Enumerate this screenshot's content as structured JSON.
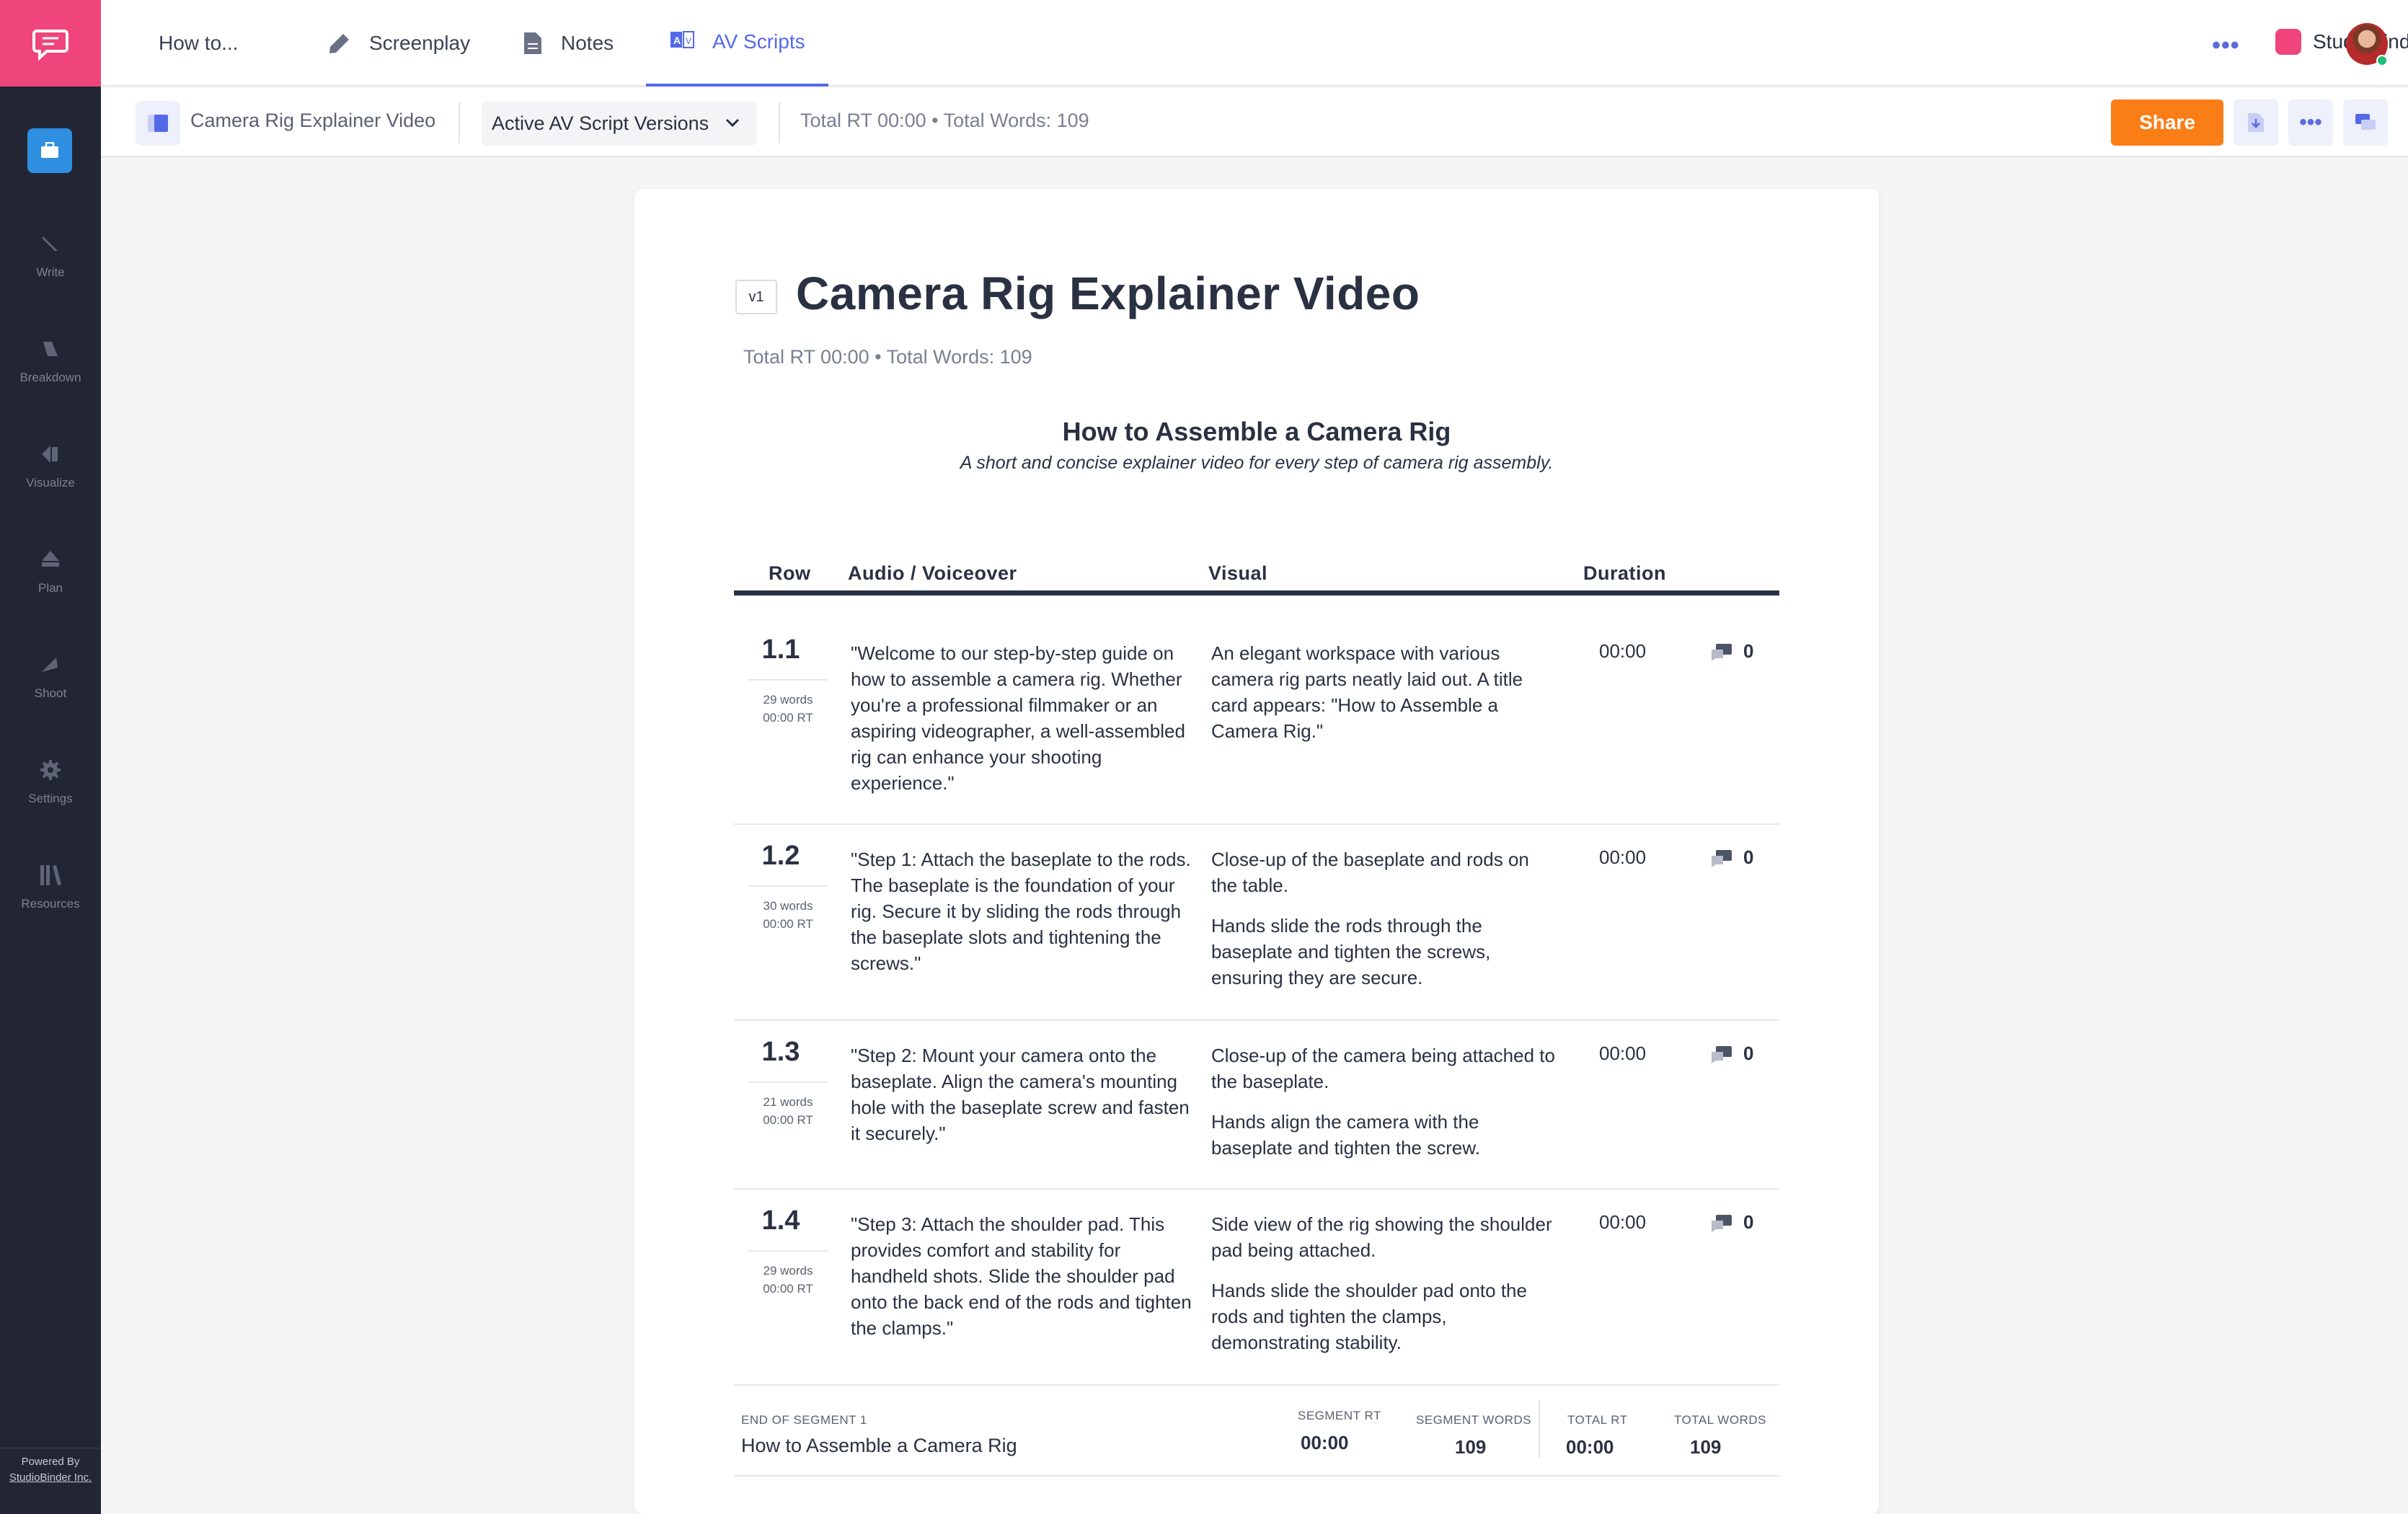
{
  "sidebar": {
    "items": [
      {
        "label": "Write",
        "icon": "pencil-icon"
      },
      {
        "label": "Breakdown",
        "icon": "breakdown-icon"
      },
      {
        "label": "Visualize",
        "icon": "visualize-icon"
      },
      {
        "label": "Plan",
        "icon": "plan-icon"
      },
      {
        "label": "Shoot",
        "icon": "shoot-icon"
      },
      {
        "label": "Settings",
        "icon": "gear-icon"
      },
      {
        "label": "Resources",
        "icon": "books-icon"
      }
    ],
    "powered_by": "Powered By",
    "company": "StudioBinder Inc."
  },
  "topbar": {
    "tabs": [
      {
        "label": "How to..."
      },
      {
        "label": "Screenplay"
      },
      {
        "label": "Notes"
      },
      {
        "label": "AV Scripts"
      }
    ],
    "more": "•••",
    "brand": "StudioBinder"
  },
  "subbar": {
    "project_title": "Camera Rig Explainer Video",
    "version_select": "Active AV Script Versions",
    "totals": "Total RT 00:00 • Total Words: 109",
    "share_label": "Share",
    "more": "•••"
  },
  "document": {
    "version_badge": "v1",
    "title": "Camera Rig Explainer Video",
    "totals": "Total RT 00:00 • Total Words: 109",
    "segment_title": "How to Assemble a Camera Rig",
    "segment_subtitle": "A short and concise explainer video for every step of camera rig assembly.",
    "columns": {
      "row": "Row",
      "audio": "Audio / Voiceover",
      "visual": "Visual",
      "duration": "Duration"
    },
    "rows": [
      {
        "num": "1.1",
        "words": "29 words",
        "rt": "00:00 RT",
        "audio": "\"Welcome to our step-by-step guide on how to assemble a camera rig. Whether you're a professional filmmaker or an aspiring videographer, a well-assembled rig can enhance your shooting experience.\"",
        "visual1": "An elegant workspace with various camera rig parts neatly laid out. A title card appears: \"How to Assemble a Camera Rig.\"",
        "visual2": "",
        "duration": "00:00",
        "comments": "0"
      },
      {
        "num": "1.2",
        "words": "30 words",
        "rt": "00:00 RT",
        "audio": "\"Step 1: Attach the baseplate to the rods. The baseplate is the foundation of your rig. Secure it by sliding the rods through the baseplate slots and tightening the screws.\"",
        "visual1": "Close-up of the baseplate and rods on the table.",
        "visual2": "Hands slide the rods through the baseplate and tighten the screws, ensuring they are secure.",
        "duration": "00:00",
        "comments": "0"
      },
      {
        "num": "1.3",
        "words": "21 words",
        "rt": "00:00 RT",
        "audio": "\"Step 2: Mount your camera onto the baseplate. Align the camera's mounting hole with the baseplate screw and fasten it securely.\"",
        "visual1": "Close-up of the camera being attached to the baseplate.",
        "visual2": "Hands align the camera with the baseplate and tighten the screw.",
        "duration": "00:00",
        "comments": "0"
      },
      {
        "num": "1.4",
        "words": "29 words",
        "rt": "00:00 RT",
        "audio": "\"Step 3: Attach the shoulder pad. This provides comfort and stability for handheld shots. Slide the shoulder pad onto the back end of the rods and tighten the clamps.\"",
        "visual1": "Side view of the rig showing the shoulder pad being attached.",
        "visual2": "Hands slide the shoulder pad onto the rods and tighten the clamps, demonstrating stability.",
        "duration": "00:00",
        "comments": "0"
      }
    ],
    "footer": {
      "end_label": "END OF SEGMENT 1",
      "segment_name": "How to Assemble a Camera Rig",
      "segment_rt_label": "SEGMENT RT",
      "segment_rt": "00:00",
      "segment_words_label": "SEGMENT WORDS",
      "segment_words": "109",
      "total_rt_label": "TOTAL RT",
      "total_rt": "00:00",
      "total_words_label": "TOTAL WORDS",
      "total_words": "109"
    }
  },
  "colors": {
    "accent": "#5469e8",
    "brand": "#f0457a",
    "share": "#fa7d16",
    "sidebar": "#222634"
  }
}
